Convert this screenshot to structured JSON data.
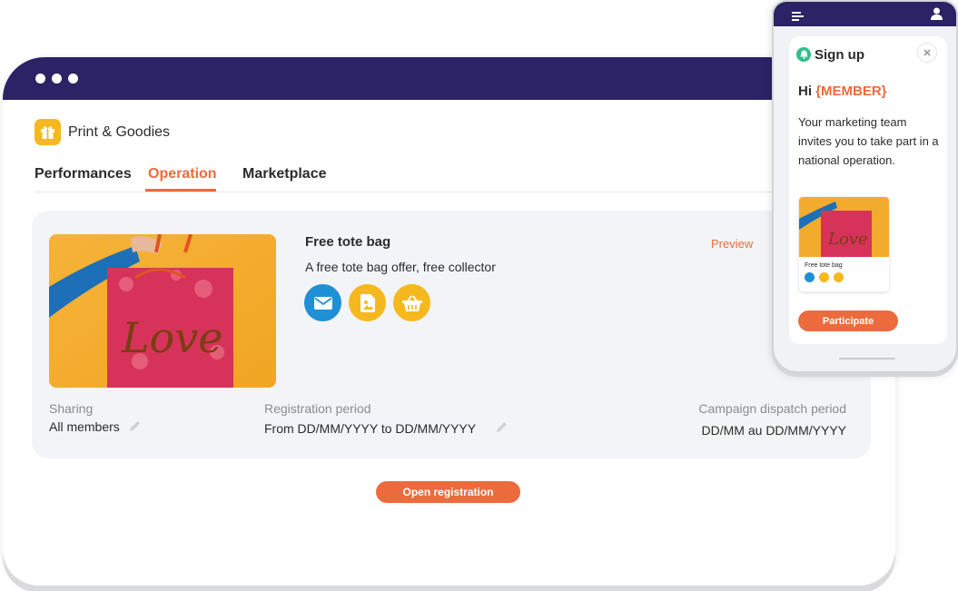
{
  "window": {
    "dots": 3
  },
  "brand": {
    "title": "Print & Goodies",
    "icon": "gift-icon",
    "icon_color": "#f5b81f"
  },
  "tabs": [
    {
      "label": "Performances",
      "active": false
    },
    {
      "label": "Operation",
      "active": true
    },
    {
      "label": "Marketplace",
      "active": false
    }
  ],
  "offer": {
    "title": "Free tote bag",
    "description": "A free tote bag offer, free collector",
    "preview_label": "Preview",
    "image": "red floral tote bag with Love lettering on yellow background",
    "channels": [
      {
        "icon": "email-icon",
        "color": "#1f8fd6"
      },
      {
        "icon": "print-document-icon",
        "color": "#f5b81f"
      },
      {
        "icon": "basket-icon",
        "color": "#f5b81f"
      }
    ]
  },
  "meta": {
    "sharing_label": "Sharing",
    "sharing_value": "All members",
    "registration_label": "Registration period",
    "registration_value": "From DD/MM/YYYY to DD/MM/YYYY",
    "dispatch_label": "Campaign dispatch period",
    "dispatch_value": "DD/MM au DD/MM/YYYY"
  },
  "actions": {
    "open_registration": "Open registration"
  },
  "phone": {
    "signup_title": "Sign up",
    "hi": "Hi",
    "member_tag": "{MEMBER}",
    "invite_text": "Your marketing team invites you to take part in a national operation.",
    "mini_title": "Free tote bag",
    "participate": "Participate"
  },
  "colors": {
    "navy": "#2b2366",
    "accent": "#ec6b3d",
    "yellow": "#f5b81f",
    "blue": "#1f8fd6",
    "green": "#2fbf86"
  }
}
